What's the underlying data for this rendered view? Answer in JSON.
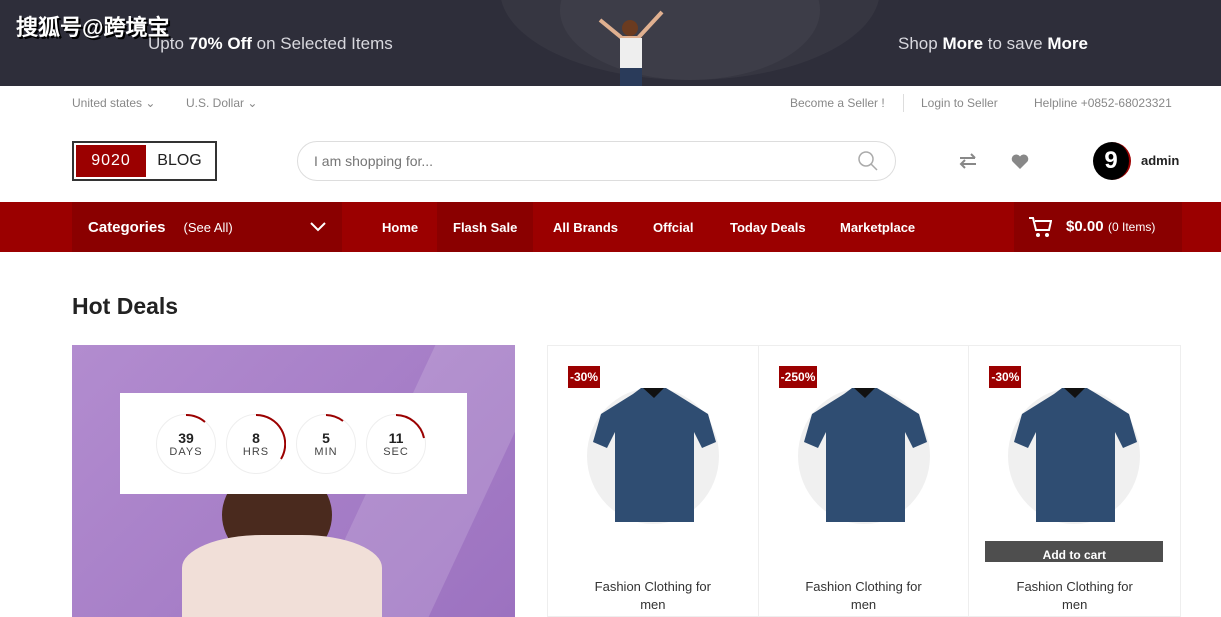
{
  "watermark": "搜狐号@跨境宝",
  "banner": {
    "left_pre": "Upto ",
    "left_bold": "70% Off",
    "left_post": " on Selected Items",
    "right_pre": "Shop ",
    "right_bold1": "More",
    "right_mid": " to save ",
    "right_bold2": "More"
  },
  "topbar": {
    "country": "United states",
    "currency": "U.S. Dollar",
    "become_seller": "Become a Seller !",
    "login_seller": "Login to Seller",
    "helpline": "Helpline +0852-68023321"
  },
  "logo": {
    "part1": "9020",
    "part2": "BLOG"
  },
  "search": {
    "placeholder": "I am shopping for..."
  },
  "user": {
    "avatar_letter": "9",
    "name": "admin"
  },
  "nav": {
    "categories": "Categories",
    "see_all": "(See All)",
    "items": [
      "Home",
      "Flash Sale",
      "All Brands",
      "Offcial",
      "Today Deals",
      "Marketplace"
    ],
    "active": "Flash Sale",
    "cart_total": "$0.00",
    "cart_items": "(0 Items)"
  },
  "hot_deals": {
    "title": "Hot Deals",
    "countdown": [
      {
        "value": "39",
        "label": "DAYS"
      },
      {
        "value": "8",
        "label": "HRS"
      },
      {
        "value": "5",
        "label": "MIN"
      },
      {
        "value": "11",
        "label": "SEC"
      }
    ]
  },
  "products": [
    {
      "badge": "-30%",
      "title": "Fashion Clothing for men"
    },
    {
      "badge": "-250%",
      "title": "Fashion Clothing for men"
    },
    {
      "badge": "-30%",
      "title": "Fashion Clothing for men",
      "action": "Add to cart"
    }
  ],
  "colors": {
    "brand": "#9b0000",
    "banner": "#2e2e3a",
    "product": "#2f4d72"
  }
}
